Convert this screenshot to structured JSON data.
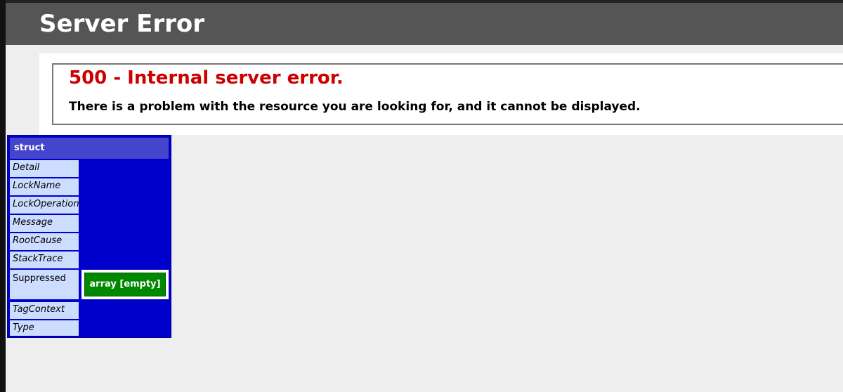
{
  "header": {
    "title": "Server Error"
  },
  "error": {
    "heading": "500 - Internal server error.",
    "message": "There is a problem with the resource you are looking for, and it cannot be displayed."
  },
  "dump": {
    "type_label": "struct",
    "keys": [
      "Detail",
      "LockName",
      "LockOperation",
      "Message",
      "RootCause",
      "StackTrace",
      "Suppressed",
      "TagContext",
      "Type"
    ],
    "suppressed_value": "array [empty]"
  },
  "colors": {
    "header": "#555555",
    "error": "#cc0000",
    "struct": "#0000cc",
    "array": "#008800"
  }
}
